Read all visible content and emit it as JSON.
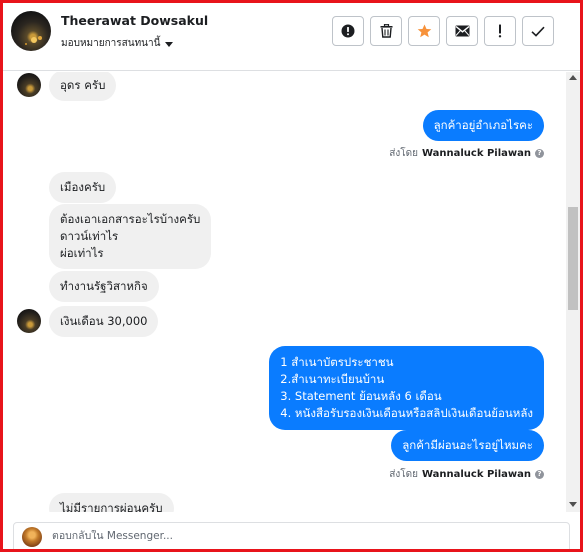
{
  "header": {
    "contact_name": "Theerawat Dowsakul",
    "assign_label": "มอบหมายการสนทนานี้"
  },
  "toolbar": {
    "buttons": [
      {
        "name": "mark-spam",
        "icon": "exclamation-circle-icon"
      },
      {
        "name": "delete",
        "icon": "trash-icon"
      },
      {
        "name": "star",
        "icon": "star-icon"
      },
      {
        "name": "mark-unread",
        "icon": "envelope-icon"
      },
      {
        "name": "flag",
        "icon": "exclamation-icon"
      },
      {
        "name": "mark-done",
        "icon": "checkmark-icon"
      }
    ],
    "star_color": "#f7923b"
  },
  "messages": {
    "m1": "อุดร ครับ",
    "m2": "ลูกค้าอยู่อำเภอไรคะ",
    "m2_sent_prefix": "ส่งโดย",
    "m2_sent_name": "Wannaluck Pilawan",
    "m3": "เมืองครับ",
    "m4_line1": "ต้องเอาเอกสารอะไรบ้างครับ",
    "m4_line2": "ดาวน์เท่าไร",
    "m4_line3": "ผ่อเท่าไร",
    "m5": "ทำงานรัฐวิสาหกิจ",
    "m6": "เงินเดือน 30,000",
    "m7_line1": "1 สำเนาบัตรประชาชน",
    "m7_line2": "2.สำเนาทะเบียนบ้าน",
    "m7_line3": " 3. Statement ย้อนหลัง 6 เดือน",
    "m7_line4": "4. หนังสือรับรองเงินเดือนหรือสลิปเงินเดือนย้อนหลัง",
    "m8": "ลูกค้ามีผ่อนอะไรอยู่ไหมคะ",
    "m8_sent_prefix": "ส่งโดย",
    "m8_sent_name": "Wannaluck Pilawan",
    "m9": "ไม่มีรายการผ่อนครับ"
  },
  "composer": {
    "placeholder": "ตอบกลับใน Messenger..."
  },
  "colors": {
    "outgoing_bubble": "#0a7cff",
    "incoming_bubble": "#f0f0f0",
    "frame_border": "#e8141b"
  }
}
